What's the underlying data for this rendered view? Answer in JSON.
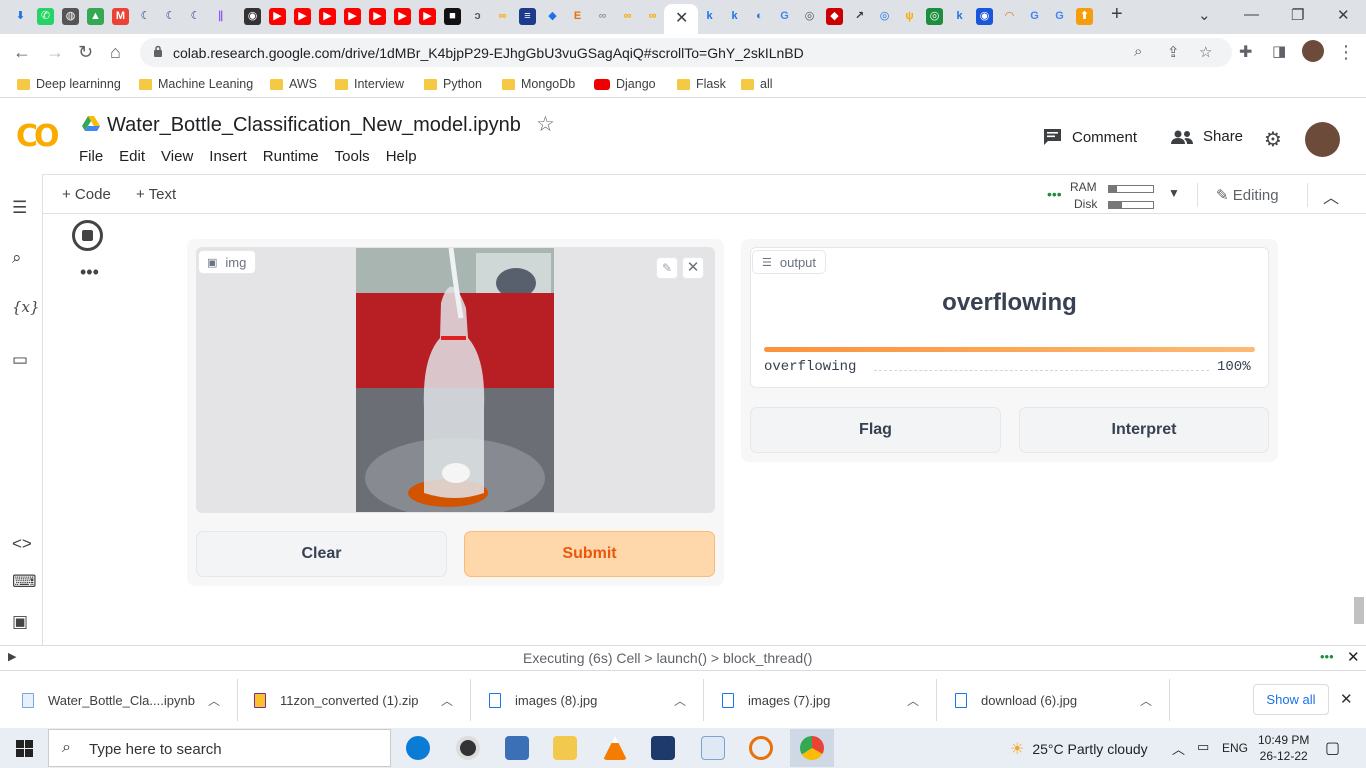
{
  "browser": {
    "url": "colab.research.google.com/drive/1dMBr_K4bjpP29-EJhgGbU3vuGSagAqiQ#scrollTo=GhY_2skILnBD",
    "bookmarks": [
      "Deep learninng",
      "Machine Leaning",
      "AWS",
      "Interview",
      "Python",
      "MongoDb",
      "Django",
      "Flask",
      "all"
    ]
  },
  "colab": {
    "notebook_title": "Water_Bottle_Classification_New_model.ipynb",
    "menu": [
      "File",
      "Edit",
      "View",
      "Insert",
      "Runtime",
      "Tools",
      "Help"
    ],
    "comment_label": "Comment",
    "share_label": "Share",
    "add_code": "+ Code",
    "add_text": "+ Text",
    "ram_label": "RAM",
    "disk_label": "Disk",
    "editing_label": "Editing",
    "status": "Executing (6s)  Cell > launch() > block_thread()"
  },
  "gradio": {
    "input_label": "img",
    "clear_label": "Clear",
    "submit_label": "Submit",
    "output_label": "output",
    "prediction": "overflowing",
    "confidences": [
      {
        "label": "overflowing",
        "percent_text": "100%",
        "value": 1.0
      }
    ],
    "flag_label": "Flag",
    "interpret_label": "Interpret"
  },
  "downloads": {
    "items": [
      "Water_Bottle_Cla....ipynb",
      "11zon_converted (1).zip",
      "images (8).jpg",
      "images (7).jpg",
      "download (6).jpg"
    ],
    "show_all": "Show all"
  },
  "taskbar": {
    "search_placeholder": "Type here to search",
    "weather": "25°C  Partly cloudy",
    "lang": "ENG",
    "time": "10:49 PM",
    "date": "26-12-22"
  },
  "colors": {
    "accent_orange": "#f97316",
    "submit_bg": "#fed7aa",
    "colab_logo": "#f9ab00"
  }
}
